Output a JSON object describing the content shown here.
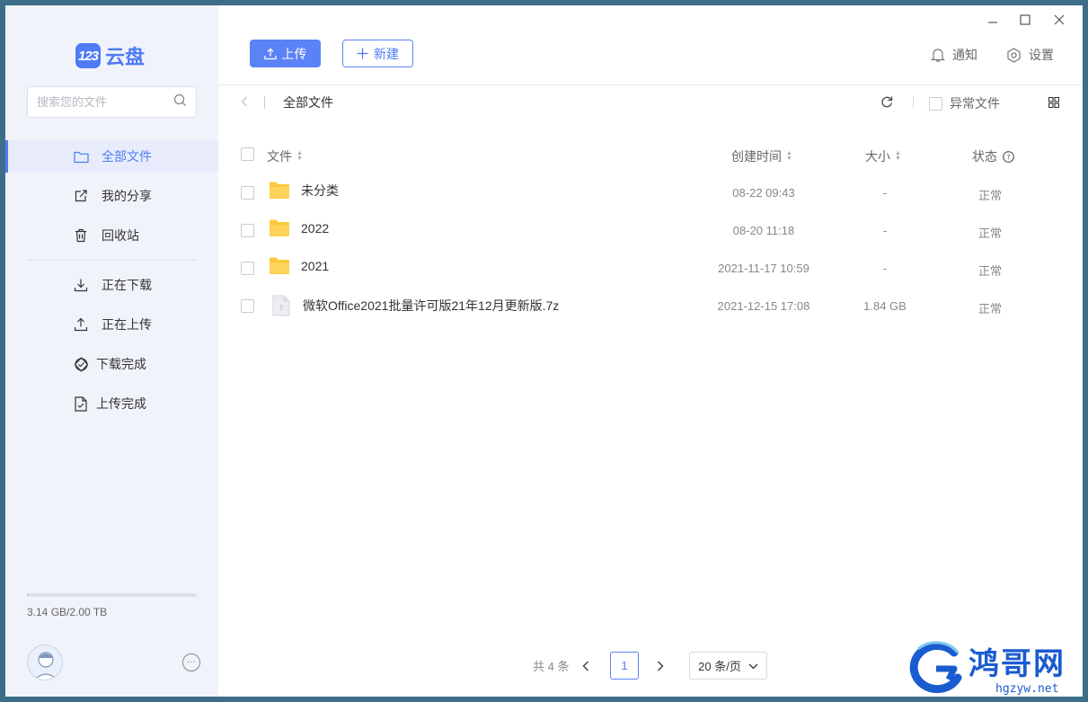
{
  "app": {
    "logo_badge": "123",
    "logo_text": "云盘"
  },
  "search": {
    "placeholder": "搜索您的文件"
  },
  "sidebar": {
    "items": [
      {
        "label": "全部文件",
        "icon": "folder-icon",
        "active": true
      },
      {
        "label": "我的分享",
        "icon": "share-icon",
        "active": false
      },
      {
        "label": "回收站",
        "icon": "trash-icon",
        "active": false
      },
      {
        "label": "正在下载",
        "icon": "download-icon",
        "active": false
      },
      {
        "label": "正在上传",
        "icon": "upload-icon",
        "active": false
      },
      {
        "label": "下载完成",
        "icon": "download-done-icon",
        "active": false
      },
      {
        "label": "上传完成",
        "icon": "upload-done-icon",
        "active": false
      }
    ],
    "storage": {
      "text": "3.14 GB/2.00 TB",
      "used_fraction": 0.0016
    }
  },
  "toolbar": {
    "upload_label": "上传",
    "new_label": "新建",
    "notify_label": "通知",
    "settings_label": "设置"
  },
  "breadcrumb": {
    "current": "全部文件"
  },
  "filter": {
    "abnormal_label": "异常文件"
  },
  "table": {
    "headers": {
      "file": "文件",
      "created": "创建时间",
      "size": "大小",
      "status": "状态"
    },
    "rows": [
      {
        "name": "未分类",
        "type": "folder",
        "created": "08-22 09:43",
        "size": "-",
        "status": "正常"
      },
      {
        "name": "2022",
        "type": "folder",
        "created": "08-20 11:18",
        "size": "-",
        "status": "正常"
      },
      {
        "name": "2021",
        "type": "folder",
        "created": "2021-11-17 10:59",
        "size": "-",
        "status": "正常"
      },
      {
        "name": "微软Office2021批量许可版21年12月更新版.7z",
        "type": "file",
        "created": "2021-12-15 17:08",
        "size": "1.84 GB",
        "status": "正常"
      }
    ]
  },
  "pagination": {
    "total_text": "共 4 条",
    "current_page": "1",
    "page_size": "20 条/页"
  },
  "watermark": {
    "title": "鸿哥网",
    "url": "hgzyw.net"
  },
  "colors": {
    "accent": "#4f7cf5",
    "folder": "#fcc93a",
    "sidebar_bg": "#f1f3fb",
    "desktop_bg": "#3d6e89"
  }
}
